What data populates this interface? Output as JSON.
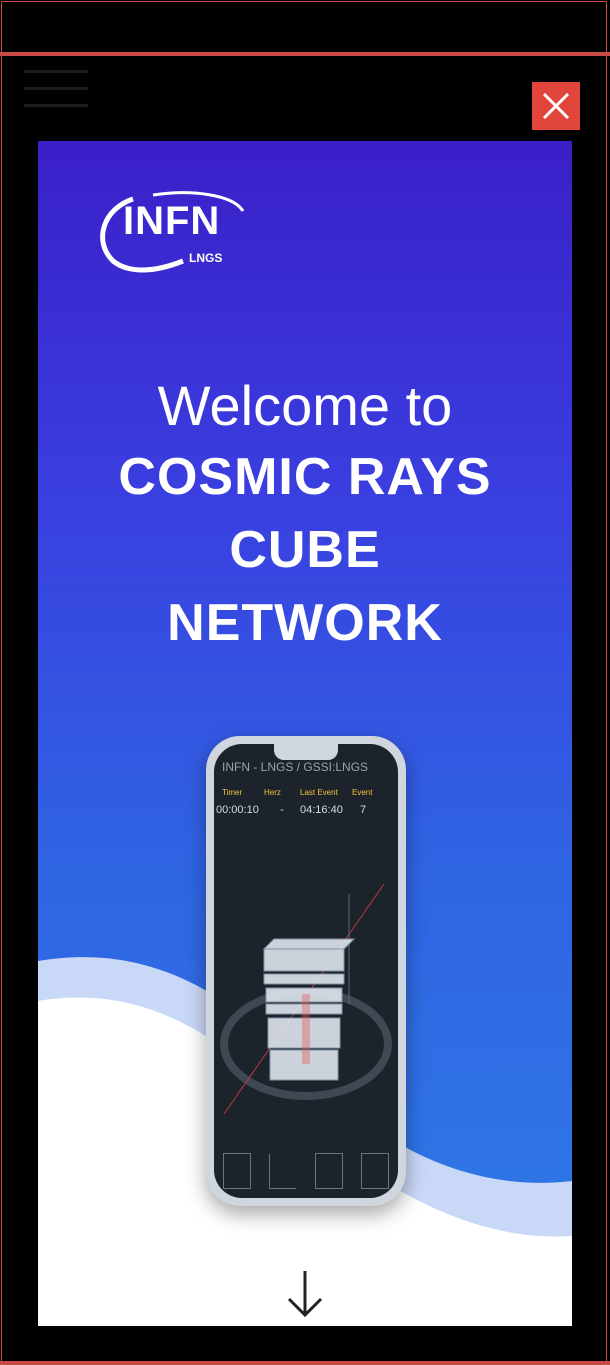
{
  "overlay": {
    "close_icon": "close-icon",
    "logo": {
      "text": "INFN",
      "sub": "LNGS"
    },
    "title": {
      "welcome": "Welcome to",
      "line1": "COSMIC RAYS",
      "line2": "CUBE",
      "line3": "NETWORK"
    },
    "phone": {
      "header": "INFN - LNGS / GSSI:LNGS",
      "labels": [
        "Timer",
        "Herz",
        "Last Event",
        "Event"
      ],
      "values": [
        "00:00:10",
        "-",
        "04:16:40",
        "7"
      ]
    },
    "scroll_icon": "arrow-down-icon"
  },
  "colors": {
    "accent": "#e2453c",
    "gradient_top": "#3a1fc8",
    "gradient_bottom": "#2f7ce6"
  }
}
